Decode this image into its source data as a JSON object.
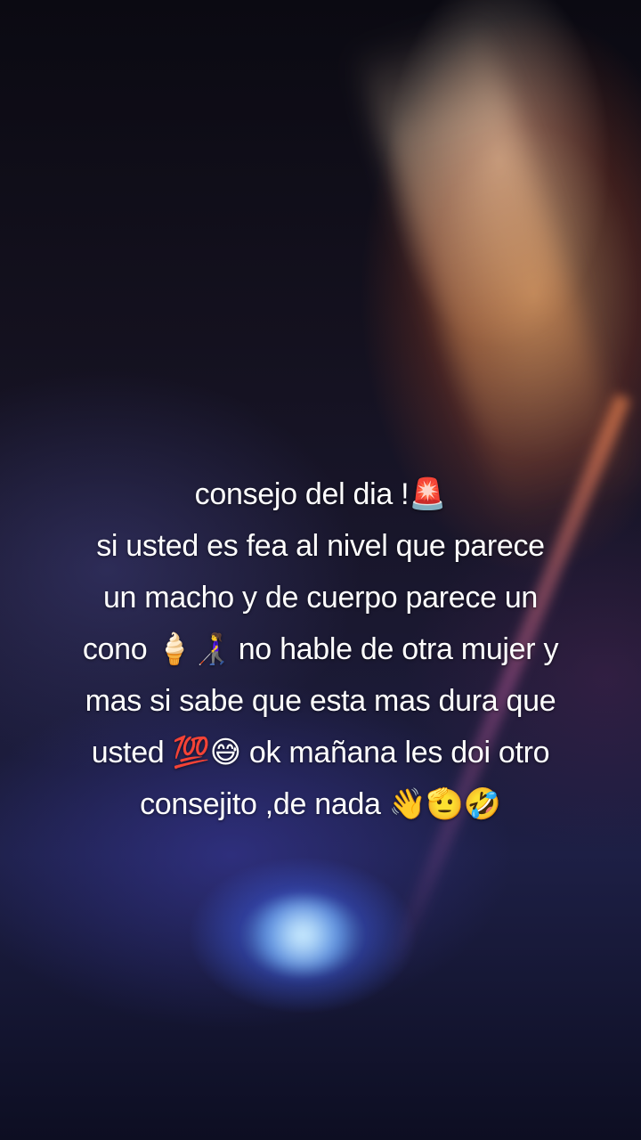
{
  "caption": {
    "lines": [
      "consejo del dia !🚨",
      "si usted es fea al nivel que parece",
      "un macho y de cuerpo parece un",
      "cono 🍦👩‍🦯 no hable de otra mujer y",
      "mas si sabe que esta mas dura que",
      "usted 💯😅 ok mañana les doi otro",
      "consejito ,de nada 👋🫡🤣"
    ]
  }
}
